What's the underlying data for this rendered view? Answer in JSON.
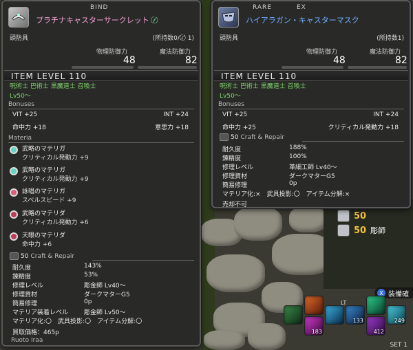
{
  "left": {
    "rarity_label": "BIND",
    "item_name": "プラチナキャスターサークレット",
    "gc_mark": "〄",
    "category": "頭防具",
    "owned": "(所持数0/〄 1)",
    "phys_def_label": "物理防御力",
    "mag_def_label": "魔法防御力",
    "phys_def": "48",
    "mag_def": "82",
    "item_level": "ITEM LEVEL 110",
    "jobs": "呪術士 巴術士 黒魔道士 召喚士",
    "level": "Lv50～",
    "bonuses_title": "Bonuses",
    "bonuses": [
      {
        "label": "VIT +25",
        "pos": "left"
      },
      {
        "label": "INT +24",
        "pos": "right"
      },
      {
        "label": "命中力 +18",
        "pos": "left"
      },
      {
        "label": "意思力 +18",
        "pos": "right"
      }
    ],
    "materia_title": "Materia",
    "materia": [
      {
        "name": "武略のマテリガ",
        "bonus": "クリティカル発動力 +9",
        "color": "#5fd6c6"
      },
      {
        "name": "武略のマテリガ",
        "bonus": "クリティカル発動力 +9",
        "color": "#5fd6c6"
      },
      {
        "name": "詠唱のマテリガ",
        "bonus": "スペルスピード +9",
        "color": "#e05a7a"
      },
      {
        "name": "武略のマテリダ",
        "bonus": "クリティカル発動力 +6",
        "color": "#c03a5a"
      },
      {
        "name": "天眼のマテリダ",
        "bonus": "命中力 +6",
        "color": "#c03a5a"
      }
    ],
    "craft_level": "50",
    "craft_title": "Craft & Repair",
    "craft": [
      {
        "label": "耐久度",
        "value": "143%"
      },
      {
        "label": "錬精度",
        "value": "53%"
      },
      {
        "label": "修理レベル",
        "value": "彫金師 Lv40～"
      },
      {
        "label": "修理資材",
        "value": "ダークマターG5"
      },
      {
        "label": "簡易修理",
        "value": "0p"
      },
      {
        "label": "マテリア装着レベル",
        "value": "彫金師 Lv50～"
      }
    ],
    "flags": "マテリア化:〇　武具投影:〇　アイテム分解:〇",
    "sell_price": "買取価格：465p",
    "owner": "Ruoto Iraa"
  },
  "right": {
    "rarity_labels": [
      "RARE",
      "EX"
    ],
    "item_name": "ハイアラガン・キャスターマスク",
    "category": "頭防具",
    "owned": "(所持数1)",
    "phys_def_label": "物理防御力",
    "mag_def_label": "魔法防御力",
    "phys_def": "48",
    "mag_def": "82",
    "item_level": "ITEM LEVEL 110",
    "jobs": "呪術士 巴術士 黒魔道士 召喚士",
    "level": "Lv50～",
    "bonuses_title": "Bonuses",
    "bonuses": [
      {
        "label": "VIT +25",
        "pos": "left"
      },
      {
        "label": "INT +24",
        "pos": "right"
      },
      {
        "label": "命中力 +25",
        "pos": "left"
      },
      {
        "label": "クリティカル発動力 +18",
        "pos": "right"
      }
    ],
    "craft_level": "50",
    "craft_title": "Craft & Repair",
    "craft": [
      {
        "label": "耐久度",
        "value": "188%"
      },
      {
        "label": "錬精度",
        "value": "100%"
      },
      {
        "label": "修理レベル",
        "value": "革細工師 Lv40～"
      },
      {
        "label": "修理資材",
        "value": "ダークマターG5"
      },
      {
        "label": "簡易修理",
        "value": "0p"
      }
    ],
    "flags": "マテリア化:×　武具投影:〇　アイテム分解:×",
    "unsellable": "売却不可"
  },
  "hud": {
    "rows": [
      {
        "num": "50",
        "label": ""
      },
      {
        "num": "50",
        "label": "彫師"
      }
    ],
    "equip_hint": "装備確",
    "x_button": "X",
    "lt_label": "LT",
    "set_label": "SET 1",
    "slot_numbers": [
      "183",
      "133",
      "412",
      "249"
    ]
  }
}
